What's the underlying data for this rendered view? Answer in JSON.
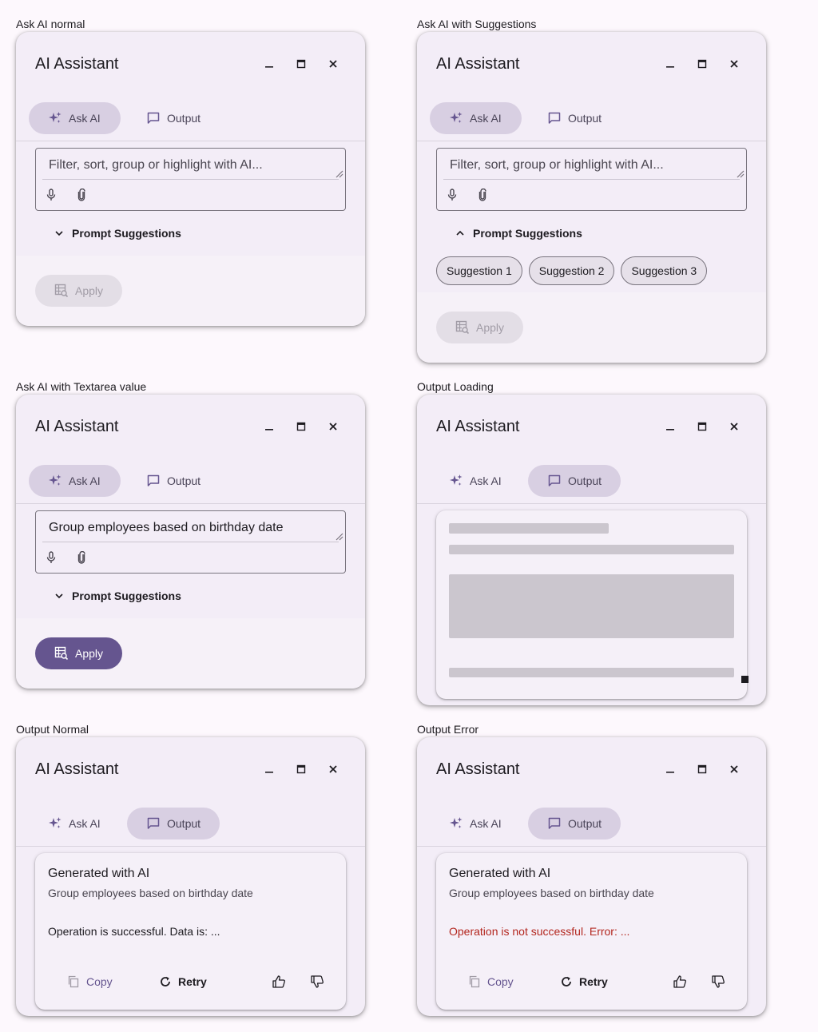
{
  "captions": {
    "a": "Ask AI normal",
    "b": "Ask AI with Suggestions",
    "c": "Ask AI with Textarea value",
    "d": "Output Loading",
    "e": "Output Normal",
    "f": "Output Error"
  },
  "window": {
    "title": "AI Assistant",
    "minimize_icon": "minimize-icon",
    "maximize_icon": "maximize-icon",
    "close_icon": "close-icon"
  },
  "tabs": {
    "ask": "Ask AI",
    "output": "Output",
    "ask_icon": "sparkle-icon",
    "output_icon": "chat-bubble-icon"
  },
  "textarea": {
    "placeholder": "Filter, sort, group or highlight with AI...",
    "value": "Group employees based on birthday date",
    "mic_icon": "microphone-icon",
    "attach_icon": "paperclip-icon"
  },
  "suggestions": {
    "label": "Prompt Suggestions",
    "chips": [
      "Suggestion 1",
      "Suggestion 2",
      "Suggestion 3"
    ]
  },
  "apply": {
    "label": "Apply",
    "icon": "table-search-icon"
  },
  "output": {
    "heading": "Generated with AI",
    "prompt": "Group employees based on birthday date",
    "success": "Operation is successful. Data is: ...",
    "error": "Operation is not successful. Error: ...",
    "copy": "Copy",
    "retry": "Retry"
  },
  "colors": {
    "primary": "#65558f",
    "error": "#b3261e",
    "surface": "#f3edf7",
    "active_tab": "#d8cfe2"
  }
}
